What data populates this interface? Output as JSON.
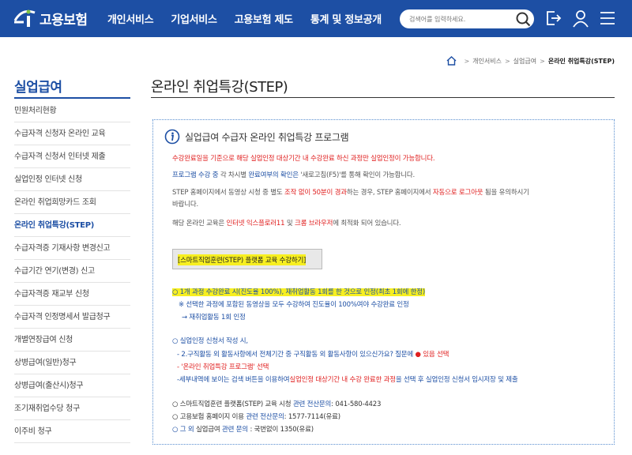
{
  "header": {
    "logo_text": "고용보험",
    "nav": [
      "개인서비스",
      "기업서비스",
      "고용보험 제도",
      "통계 및 정보공개"
    ],
    "search_placeholder": "검색어를 입력하세요."
  },
  "breadcrumb": [
    "개인서비스",
    "실업급여",
    "온라인 취업특강(STEP)"
  ],
  "sidebar": {
    "title": "실업급여",
    "items": [
      "민원처리현황",
      "수급자격 신청자 온라인 교육",
      "수급자격 신청서 인터넷 제출",
      "실업인정 인터넷 신청",
      "온라인 취업희망카드 조회",
      "온라인 취업특강(STEP)",
      "수급자격증 기재사항 변경신고",
      "수급기간 연기(변경) 신고",
      "수급자격증 재교부 신청",
      "수급자격 인정명세서 발급청구",
      "개별연장급여 신청",
      "상병급여(일반)청구",
      "상병급여(출산시)청구",
      "조기재취업수당 청구",
      "이주비 청구"
    ],
    "active_index": 5
  },
  "main": {
    "page_title": "온라인 취업특강(STEP)",
    "box_title": "실업급여 수급자 온라인 취업특강 프로그램",
    "p1": "수강완료일을 기준으로 해당 실업인정 대상기간 내 수강완료 하신 과정만 실업인정이 가능합니다.",
    "p2a": "프로그램 수강 중",
    "p2b": " 각 차시별 ",
    "p2c": "완료여부의 확인은",
    "p2d": " '새로고침(F5)'를 통해 확인이 가능합니다.",
    "p3a": "STEP 홈페이지에서 동영상 시청 중 별도 ",
    "p3b": "조작 없이 50분이 경과",
    "p3c": "하는 경우, STEP 홈페이지에서 ",
    "p3d": "자동으로 로그아웃",
    "p3e": " 됨을 유의하시기",
    "p3f": "바랍니다.",
    "p4a": "해당 온라인 교육은 ",
    "p4b": "인터넷 익스플로러11",
    "p4c": " 및 ",
    "p4d": "크롬 브라우저",
    "p4e": "에 최적화 되어 있습니다.",
    "step_button": "[스마트직업훈련(STEP) 플랫폼 교육 수강하기]",
    "n1": "○ 1개 과정 수강완료 시(진도율 100%), 재취업활동 1회를 한 것으로 인정(최초 1회에 한정)",
    "n1b": "※ 선택한 과정에 포함된 동영상을 모두 수강하여 진도율이 100%여야 수강완료 인정",
    "n1c": "→ 재취업활동 1회 인정",
    "n2": "○ 실업인정 신청서 작성 시,",
    "n2b_pre": "- 2.구직활동 외 활동사항에서 전체기간 중 구직활동 외 활동사항이 있으신가요? 질문에 ",
    "n2b_dot": "●",
    "n2b_post": " 있음 선택",
    "n2c": "- '온라인 취업특강 프로그램' 선택",
    "n2d_a": "-세부내역에 보이는 검색 버튼을 이용하여",
    "n2d_b": "실업인정 대상기간 내 수강 완료한 과정",
    "n2d_c": "을 선택 후 실업인정 신청서 임시저장 및 제출",
    "c1a": "○ 스마트직업훈련 플랫폼(STEP) 교육 시청 ",
    "c1b": "관련 전산문의",
    "c1c": ": 041-580-4423",
    "c2a": "○ 고용보험 홈페이지 이용 ",
    "c2b": "관련 전산문의",
    "c2c": ": 1577-7114(유료)",
    "c3a": "○ 그 외",
    "c3b": " 실업급여 ",
    "c3c": "관련 문의",
    "c3d": " : 국번없이 1350(유료)"
  },
  "colors": {
    "brand": "#1d4fa4",
    "highlight": "#f7ef20",
    "alert": "#e02020"
  }
}
